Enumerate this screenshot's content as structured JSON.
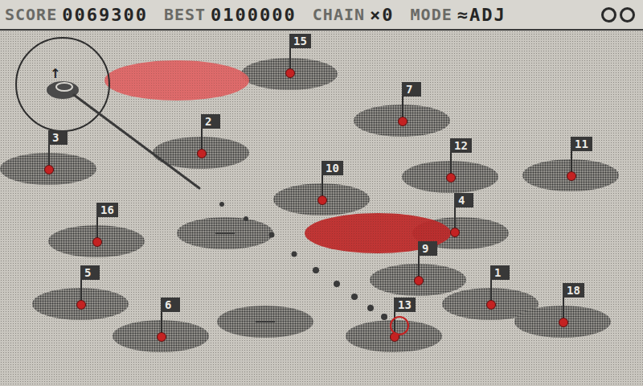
{
  "hud": {
    "score_label": "SCORE",
    "score": "0069300",
    "best_label": "BEST",
    "best": "0100000",
    "chain_label": "CHAIN",
    "chain": "×0",
    "mode_label": "MODE",
    "mode": "≈ADJ",
    "lives": 2
  },
  "holes": [
    {
      "number": "15",
      "targeted": false
    },
    {
      "number": "7",
      "targeted": false
    },
    {
      "number": "2",
      "targeted": false
    },
    {
      "number": "3",
      "targeted": false
    },
    {
      "number": "12",
      "targeted": false
    },
    {
      "number": "11",
      "targeted": false
    },
    {
      "number": "10",
      "targeted": false
    },
    {
      "number": "16",
      "targeted": false
    },
    {
      "number": "4",
      "targeted": false
    },
    {
      "number": "9",
      "targeted": false
    },
    {
      "number": "1",
      "targeted": false
    },
    {
      "number": "18",
      "targeted": false
    },
    {
      "number": "5",
      "targeted": false
    },
    {
      "number": "6",
      "targeted": false
    },
    {
      "number": "13",
      "targeted": true
    }
  ],
  "hazards": [
    {
      "color": "#e06464"
    },
    {
      "color": "#c02a2a"
    }
  ],
  "player": {
    "aim_arrow": "↑"
  }
}
